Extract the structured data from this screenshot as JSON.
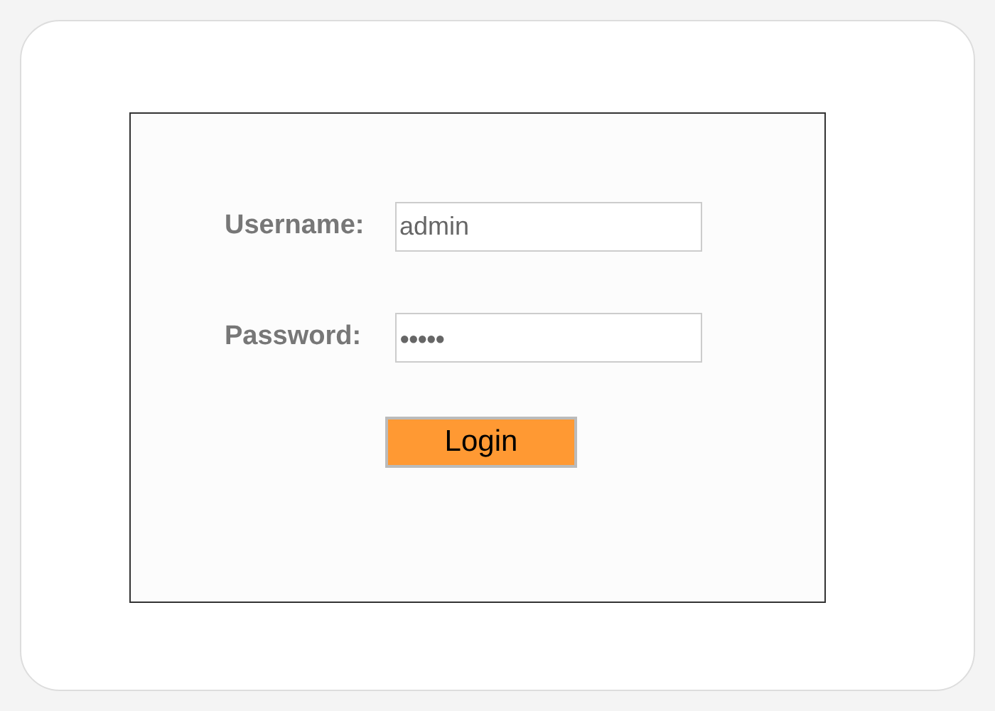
{
  "form": {
    "fields": [
      {
        "label": "Username:",
        "value": "admin",
        "kind": "text"
      },
      {
        "label": "Password:",
        "value": "●●●●●",
        "kind": "password"
      }
    ],
    "button": "Login"
  }
}
